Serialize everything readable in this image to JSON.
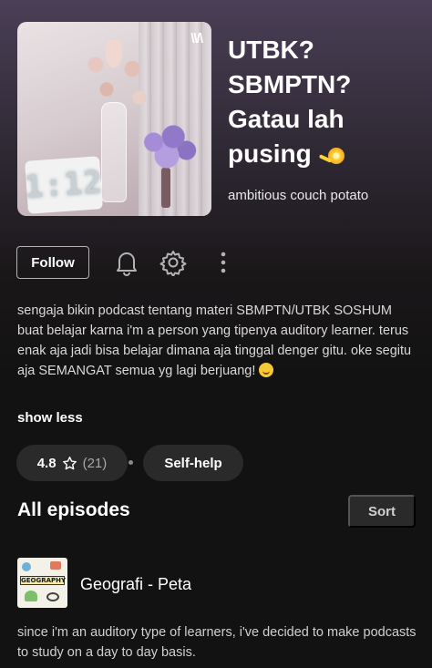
{
  "podcast": {
    "title": "UTBK? SBMPTN? Gatau lah pusing",
    "title_emoji": "dizzy-emoji",
    "author": "ambitious couch potato",
    "cover": {
      "clock_text": "1:12",
      "logo_text": "\\\\/\\"
    },
    "description": "sengaja bikin podcast tentang materi SBMPTN/UTBK SOSHUM buat belajar karna i'm a person yang tipenya auditory learner. terus enak aja jadi bisa belajar dimana aja tinggal denger gitu. oke segitu aja SEMANGAT semua yg lagi berjuang!",
    "description_emoji": "smiling-face-emoji",
    "show_less_label": "show less"
  },
  "actions": {
    "follow_label": "Follow",
    "icons": [
      "bell-icon",
      "gear-icon",
      "more-vertical-icon"
    ]
  },
  "meta": {
    "rating_value": "4.8",
    "rating_icon": "star-outline-icon",
    "rating_count": "(21)",
    "genre": "Self-help"
  },
  "episodes_section": {
    "title": "All episodes",
    "sort_label": "Sort",
    "items": [
      {
        "thumb_text": "GEOGRAPHY",
        "title": "Geografi - Peta",
        "description": "since i'm an auditory type of learners, i've decided to make podcasts to study on a day to day basis."
      }
    ]
  },
  "colors": {
    "background": "#121212",
    "header_gradient_top": "#4a3f56",
    "pill_bg": "#2a2a2a",
    "secondary_text": "#a7a7a7"
  }
}
